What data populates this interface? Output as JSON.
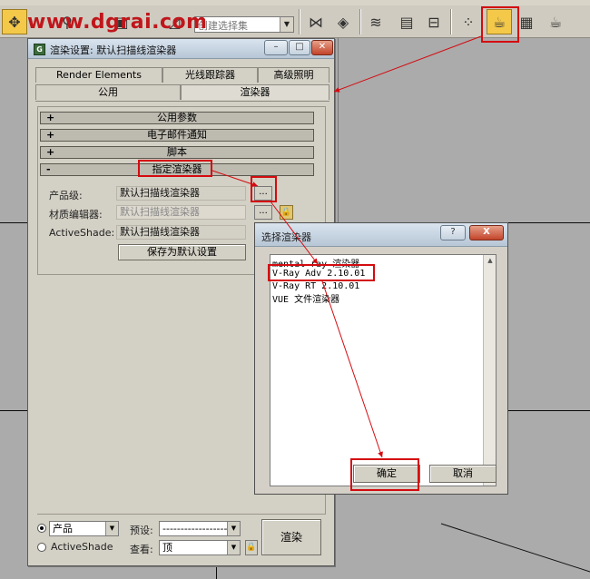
{
  "toolbar": {
    "watermark": "www.dgrai.com",
    "selection_set_placeholder": "创建选择集"
  },
  "render_dialog": {
    "title": "渲染设置: 默认扫描线渲染器",
    "tabs_row1": [
      "Render Elements",
      "光线跟踪器",
      "高级照明"
    ],
    "tabs_row2": [
      "公用",
      "渲染器"
    ],
    "rollouts": [
      {
        "sign": "+",
        "label": "公用参数"
      },
      {
        "sign": "+",
        "label": "电子邮件通知"
      },
      {
        "sign": "+",
        "label": "脚本"
      },
      {
        "sign": "-",
        "label": "指定渲染器"
      }
    ],
    "assign": {
      "production_label": "产品级:",
      "production_value": "默认扫描线渲染器",
      "material_editor_label": "材质编辑器:",
      "material_editor_value": "默认扫描线渲染器",
      "activeshade_label": "ActiveShade:",
      "activeshade_value": "默认扫描线渲染器",
      "dots_label": "...",
      "save_default_label": "保存为默认设置"
    },
    "bottom": {
      "mode_production": "产品",
      "mode_activeshade": "ActiveShade",
      "preset_label": "预设:",
      "preset_value": "-------------------",
      "view_label": "查看:",
      "view_value": "顶",
      "render_label": "渲染"
    }
  },
  "choose_dialog": {
    "title": "选择渲染器",
    "help": "?",
    "close": "X",
    "items": [
      "mental ray 渲染器",
      "V-Ray Adv 2.10.01",
      "V-Ray RT 2.10.01",
      "VUE 文件渲染器"
    ],
    "ok_label": "确定",
    "cancel_label": "取消"
  },
  "colors": {
    "annotation_red": "#d40b10",
    "toolbar_active": "#f4c94a",
    "dialog_bg": "#d3d0c5",
    "viewport_bg": "#ababab"
  },
  "icons": [
    "select-move-icon",
    "link-icon",
    "mirror-icon",
    "align-icon",
    "layer-manager-icon",
    "curve-editor-icon",
    "schematic-icon",
    "material-editor-icon",
    "render-setup-icon",
    "render-frame-icon",
    "quick-render-icon"
  ]
}
